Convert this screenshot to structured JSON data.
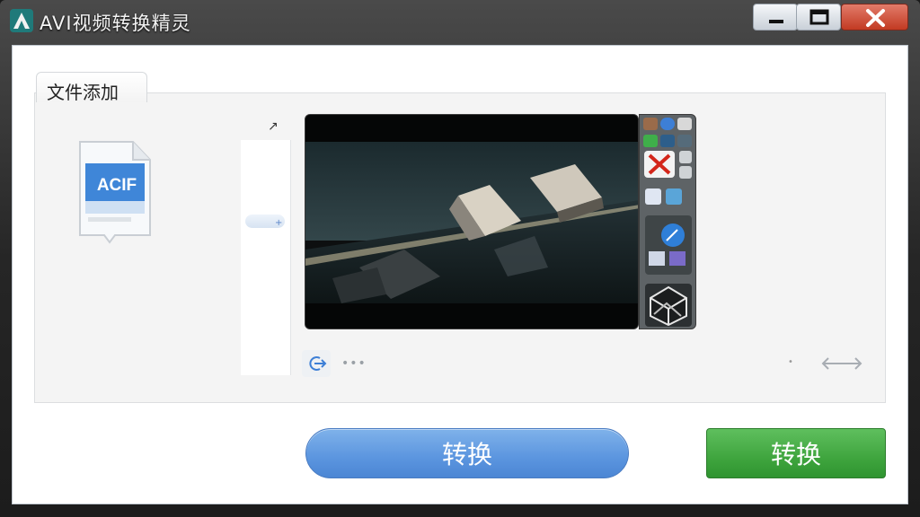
{
  "window": {
    "title": "AVI视频转换精灵",
    "controls": {
      "minimize": "minimize-icon",
      "maximize": "maximize-icon",
      "close": "close-icon"
    }
  },
  "tab": {
    "label": "文件添加"
  },
  "file_icon": {
    "label": "ACIF"
  },
  "preview": {
    "toolbar_icons": [
      "settings-icon",
      "info-icon",
      "switch-icon",
      "add-icon",
      "minus-icon",
      "close-icon",
      "cut-icon",
      "rotate-icon",
      "clip-icon",
      "mail-icon",
      "image-icon",
      "globe-icon",
      "photo-icon",
      "cube-icon"
    ]
  },
  "controls": {
    "more": "•••"
  },
  "buttons": {
    "convert_primary": "转换",
    "convert_secondary": "转换"
  },
  "colors": {
    "primary_blue": "#5b95df",
    "success_green": "#3fa53e",
    "titlebar": "#2b2b2b"
  }
}
